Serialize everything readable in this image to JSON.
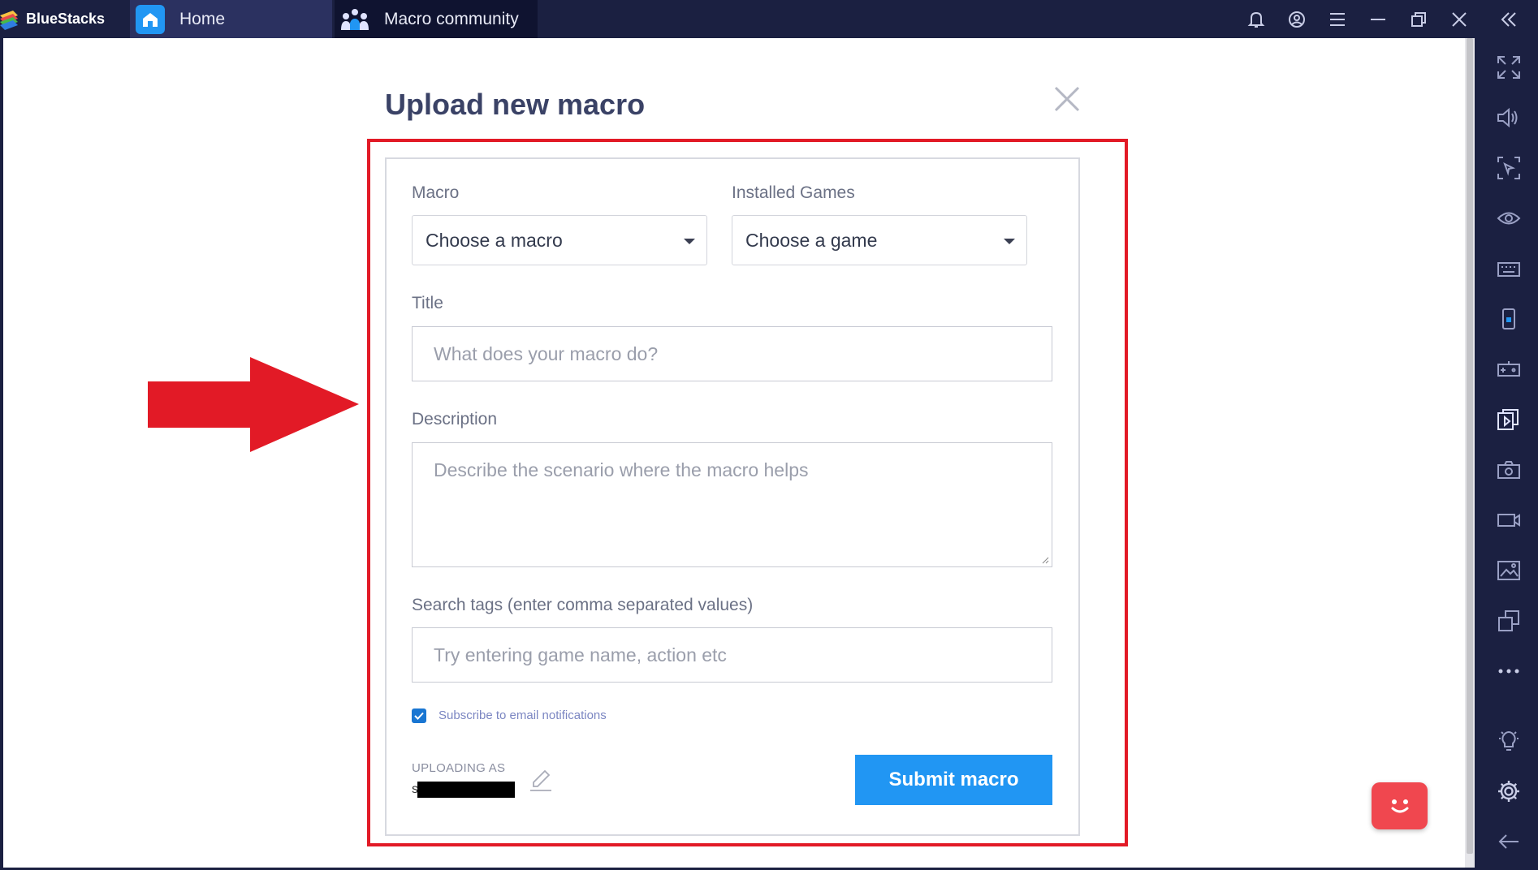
{
  "app": {
    "name": "BlueStacks"
  },
  "tabs": [
    {
      "label": "Home",
      "icon": "home-icon"
    },
    {
      "label": "Macro community",
      "icon": "community-icon"
    }
  ],
  "dialog": {
    "title": "Upload new macro",
    "macro": {
      "label": "Macro",
      "selected": "Choose a macro"
    },
    "installed_games": {
      "label": "Installed Games",
      "selected": "Choose a game"
    },
    "title_field": {
      "label": "Title",
      "placeholder": "What does your macro do?"
    },
    "description": {
      "label": "Description",
      "placeholder": "Describe the scenario where the macro helps"
    },
    "tags": {
      "label": "Search tags (enter comma separated values)",
      "placeholder": "Try entering game name, action etc"
    },
    "subscribe": {
      "label": "Subscribe to email notifications",
      "checked": true
    },
    "uploading_as": {
      "label": "UPLOADING AS",
      "name_visible": "s"
    },
    "submit_label": "Submit macro"
  },
  "colors": {
    "titlebar": "#1b2041",
    "accent": "#2196f3",
    "highlight": "#e21a26",
    "chat": "#f0474f"
  },
  "sidebar_icons": [
    "fullscreen-icon",
    "volume-icon",
    "pointer-icon",
    "eye-icon",
    "keyboard-icon",
    "phone-icon",
    "gamepad-icon",
    "macro-icon",
    "camera-icon",
    "video-icon",
    "gallery-icon",
    "multi-instance-icon",
    "more-icon",
    "bulb-icon",
    "settings-icon",
    "back-icon"
  ]
}
